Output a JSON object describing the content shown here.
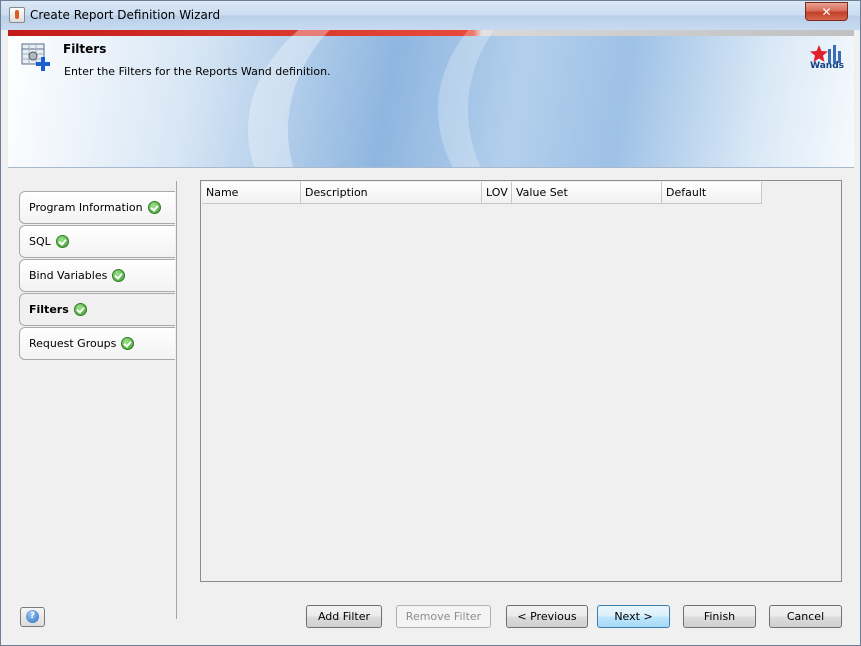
{
  "window": {
    "title": "Create Report Definition Wizard",
    "close_label": "✕"
  },
  "header": {
    "title": "Filters",
    "subtitle": "Enter the Filters for the Reports Wand definition.",
    "logo_text": "Wands"
  },
  "steps": [
    {
      "label": "Program Information",
      "complete": true,
      "active": false
    },
    {
      "label": "SQL",
      "complete": true,
      "active": false
    },
    {
      "label": "Bind Variables",
      "complete": true,
      "active": false
    },
    {
      "label": "Filters",
      "complete": true,
      "active": true
    },
    {
      "label": "Request Groups",
      "complete": true,
      "active": false
    }
  ],
  "table": {
    "columns": [
      "Name",
      "Description",
      "LOV",
      "Value Set",
      "Default"
    ],
    "rows": []
  },
  "buttons": {
    "add_filter": "Add Filter",
    "remove_filter": "Remove Filter",
    "previous": "< Previous",
    "next": "Next >",
    "finish": "Finish",
    "cancel": "Cancel",
    "help": "?"
  },
  "colors": {
    "accent_red": "#c21b1b",
    "banner_blue": "#8fb6e0",
    "check_green": "#3a9b2b"
  }
}
